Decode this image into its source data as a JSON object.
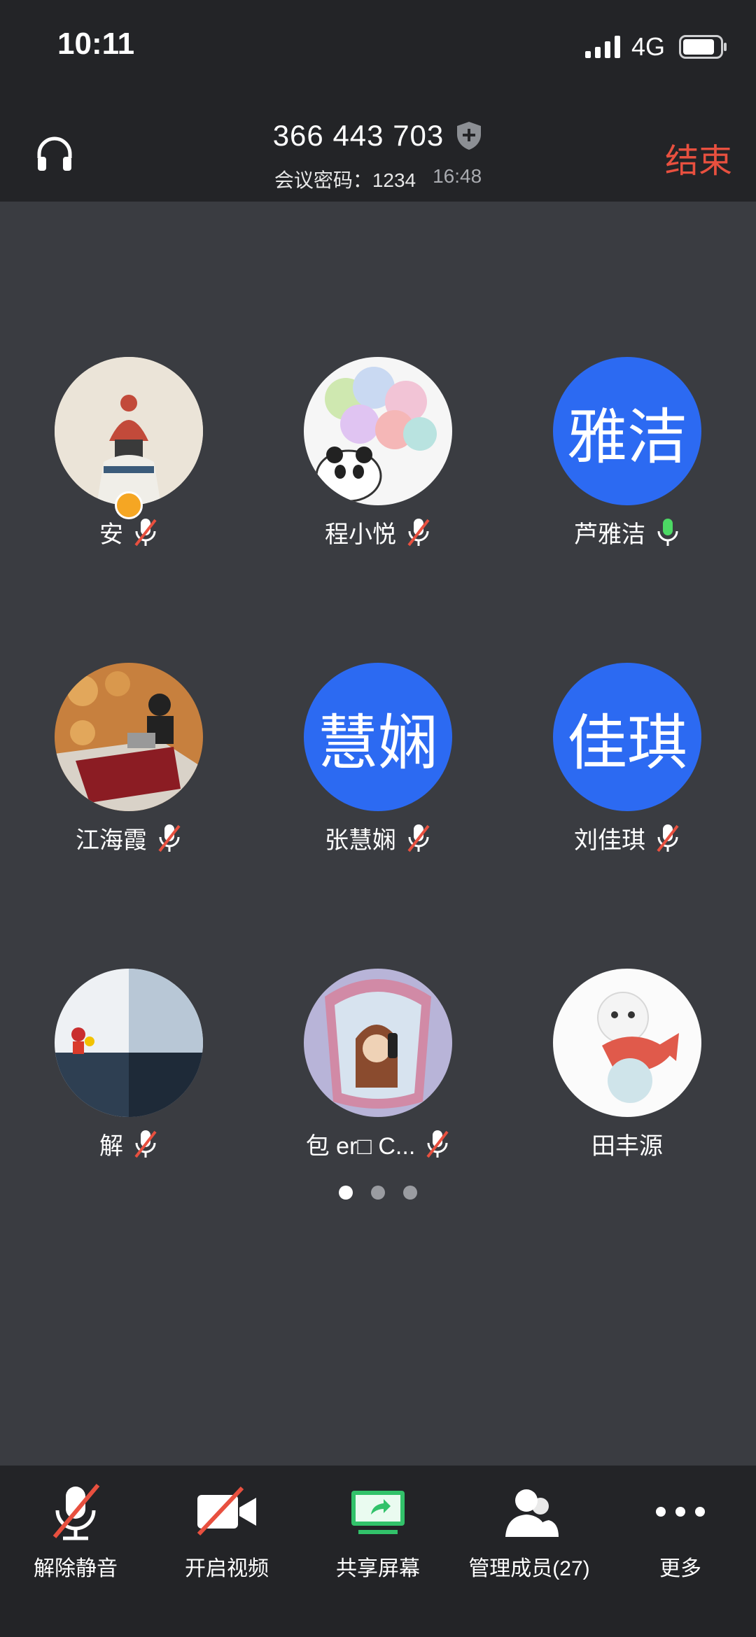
{
  "status": {
    "time": "10:11",
    "network": "4G"
  },
  "header": {
    "meeting_id": "366 443 703",
    "password_label": "会议密码：1234",
    "timer": "16:48",
    "end_label": "结束"
  },
  "participants": [
    {
      "name": "安",
      "avatar_type": "image",
      "mic": "muted",
      "host": true
    },
    {
      "name": "程小悦",
      "avatar_type": "image",
      "mic": "muted"
    },
    {
      "name": "芦雅洁",
      "avatar_type": "text",
      "avatar_text": "雅洁",
      "mic": "active"
    },
    {
      "name": "江海霞",
      "avatar_type": "image",
      "mic": "muted"
    },
    {
      "name": "张慧娴",
      "avatar_type": "text",
      "avatar_text": "慧娴",
      "mic": "muted"
    },
    {
      "name": "刘佳琪",
      "avatar_type": "text",
      "avatar_text": "佳琪",
      "mic": "muted"
    },
    {
      "name": "解",
      "avatar_type": "image",
      "mic": "muted"
    },
    {
      "name": "包 er□ C...",
      "avatar_type": "image",
      "mic": "muted"
    },
    {
      "name": "田丰源",
      "avatar_type": "image",
      "mic": "none"
    }
  ],
  "pagination": {
    "pages": 3,
    "current": 1
  },
  "toolbar": {
    "unmute": "解除静音",
    "video": "开启视频",
    "share": "共享屏幕",
    "members": "管理成员(27)",
    "more": "更多"
  },
  "colors": {
    "accent": "#2c6af2",
    "end": "#e8503f",
    "mic_active": "#4cd964",
    "mute_slash": "#e8503f"
  }
}
